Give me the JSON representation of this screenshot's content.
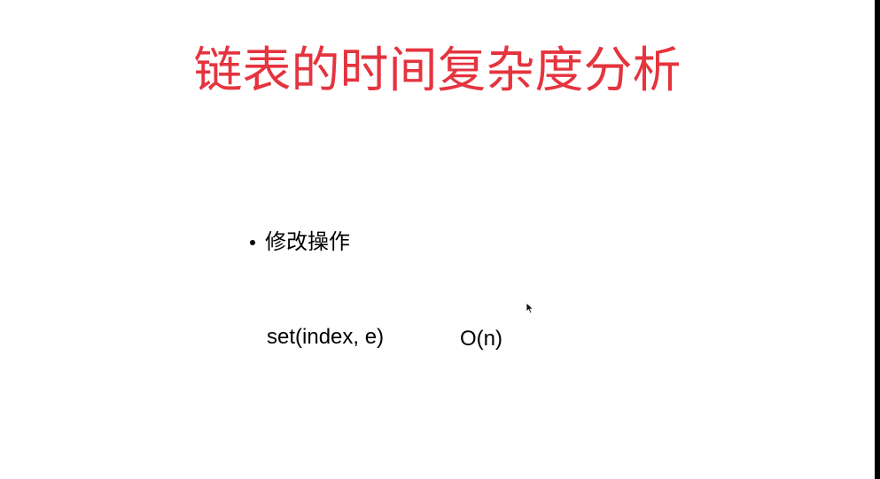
{
  "slide": {
    "title": "链表的时间复杂度分析",
    "bullet": "修改操作",
    "method": "set(index, e)",
    "complexity": "O(n)"
  },
  "colors": {
    "title": "#e5343f",
    "text": "#000000",
    "background": "#ffffff"
  },
  "icons": {
    "cursor": "mouse-pointer-icon"
  }
}
